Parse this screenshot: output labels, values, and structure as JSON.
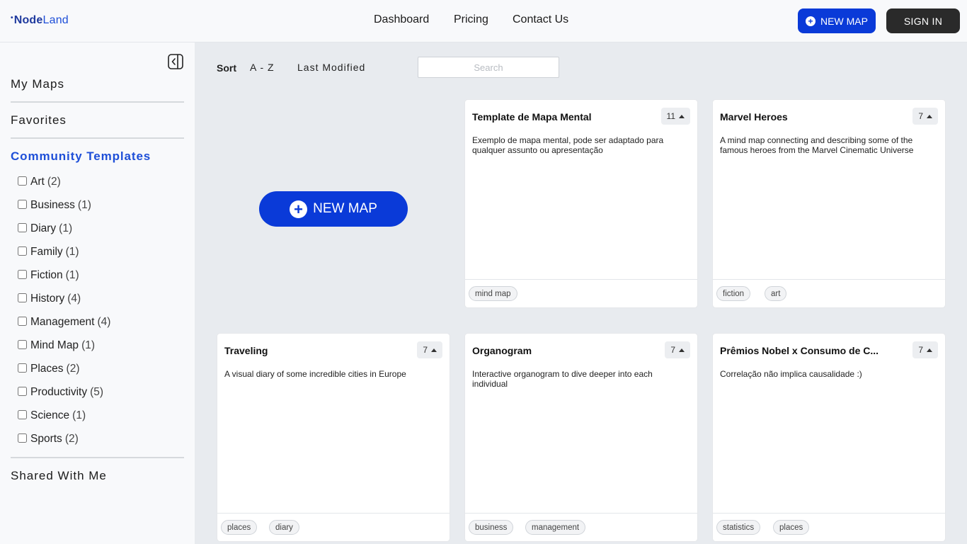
{
  "header": {
    "logo_prefix": "Node",
    "logo_suffix": "Land",
    "nav": [
      "Dashboard",
      "Pricing",
      "Contact Us"
    ],
    "new_map_label": "NEW MAP",
    "sign_in_label": "SIGN IN"
  },
  "sidebar": {
    "my_maps": "My Maps",
    "favorites": "Favorites",
    "community_templates": "Community Templates",
    "categories": [
      {
        "name": "Art",
        "count": "(2)"
      },
      {
        "name": "Business",
        "count": "(1)"
      },
      {
        "name": "Diary",
        "count": "(1)"
      },
      {
        "name": "Family",
        "count": "(1)"
      },
      {
        "name": "Fiction",
        "count": "(1)"
      },
      {
        "name": "History",
        "count": "(4)"
      },
      {
        "name": "Management",
        "count": "(4)"
      },
      {
        "name": "Mind Map",
        "count": "(1)"
      },
      {
        "name": "Places",
        "count": "(2)"
      },
      {
        "name": "Productivity",
        "count": "(5)"
      },
      {
        "name": "Science",
        "count": "(1)"
      },
      {
        "name": "Sports",
        "count": "(2)"
      }
    ],
    "shared_with_me": "Shared With Me"
  },
  "toolbar": {
    "sort_label": "Sort",
    "sort_options": [
      "A - Z",
      "Last Modified"
    ],
    "search_placeholder": "Search",
    "search_value": ""
  },
  "main": {
    "new_map_label": "NEW MAP"
  },
  "cards": [
    {
      "title": "Template de Mapa Mental",
      "votes": "11",
      "description": "Exemplo de mapa mental, pode ser adaptado para qualquer assunto ou apresentação",
      "tags": [
        "mind map"
      ]
    },
    {
      "title": "Marvel Heroes",
      "votes": "7",
      "description": "A mind map connecting and describing some of the famous heroes from the Marvel Cinematic Universe",
      "tags": [
        "fiction",
        "art"
      ]
    },
    {
      "title": "Traveling",
      "votes": "7",
      "description": "A visual diary of some incredible cities in Europe",
      "tags": [
        "places",
        "diary"
      ]
    },
    {
      "title": "Organogram",
      "votes": "7",
      "description": "Interactive organogram to dive deeper into each individual",
      "tags": [
        "business",
        "management"
      ]
    },
    {
      "title": "Prêmios Nobel x Consumo de C...",
      "votes": "7",
      "description": "Correlação não implica causalidade :)",
      "tags": [
        "statistics",
        "places"
      ]
    }
  ],
  "colors": {
    "accent": "#0a3ad8",
    "active_link": "#1e4fd8",
    "dark_button": "#2a2a2a",
    "background": "#e8ebef"
  },
  "icons": {
    "collapse": "sidebar-collapse-icon",
    "plus": "plus-circle-icon",
    "upvote": "triangle-up-icon"
  }
}
